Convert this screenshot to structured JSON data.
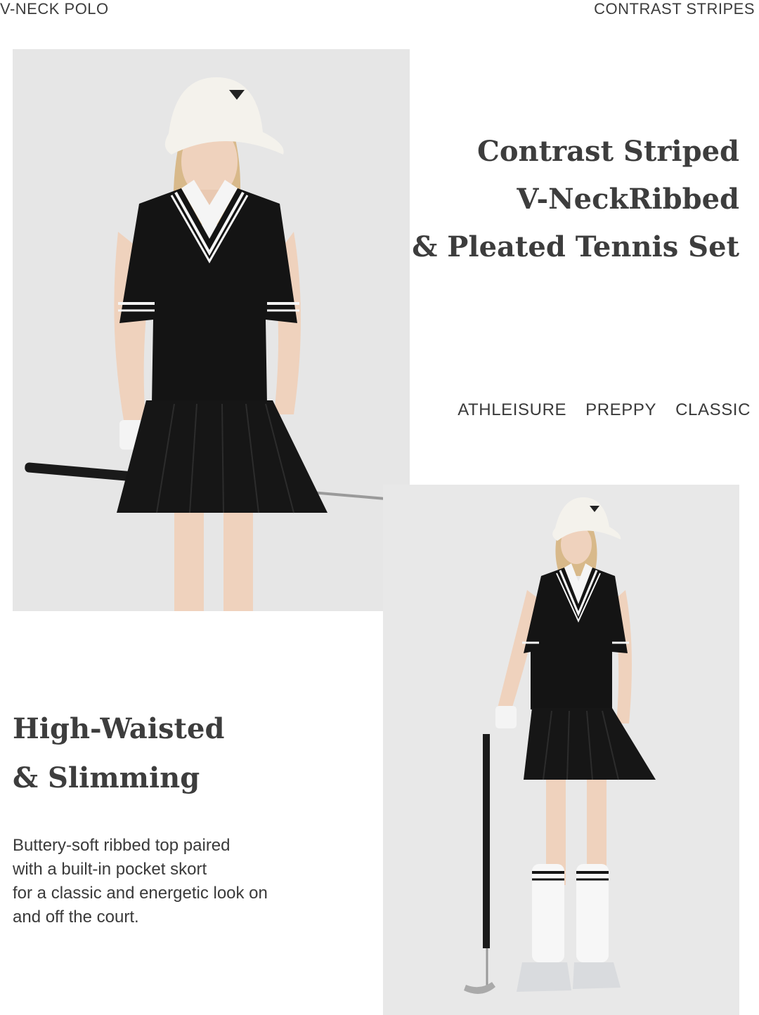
{
  "top_labels": {
    "left": "V-NECK POLO",
    "right": "CONTRAST STRIPES"
  },
  "headline": {
    "line1": "Contrast Striped",
    "line2": "V-NeckRibbed",
    "line3": "& Pleated Tennis Set"
  },
  "tags": [
    "ATHLEISURE",
    "PREPPY",
    "CLASSIC"
  ],
  "subhead": {
    "line1": "High-Waisted",
    "line2": "& Slimming"
  },
  "body_copy": {
    "line1": "Buttery-soft ribbed top paired",
    "line2": "with a built-in pocket skort",
    "line3": "for a classic and energetic look on",
    "line4": "and off the court."
  },
  "colors": {
    "background": "#ffffff",
    "photo_backdrop": "#e6e6e6",
    "garment": "#111111",
    "accent_white": "#f7f7f7",
    "text": "#3a3a3a"
  }
}
